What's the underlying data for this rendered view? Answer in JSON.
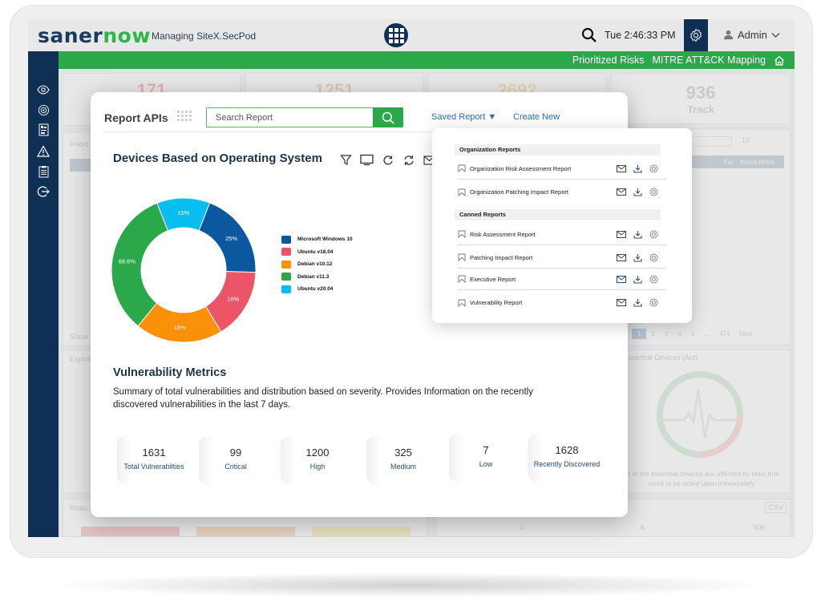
{
  "header": {
    "logo_part1": "saner",
    "logo_part2": "now",
    "managing_label": "Managing",
    "site_name": "SiteX.SecPod",
    "clock": "Tue 2:46:33 PM",
    "user": "Admin"
  },
  "greenbar": {
    "links": [
      "Prioritized Risks",
      "MITRE ATT&CK Mapping"
    ]
  },
  "sidebar": {
    "icons": [
      "eye-icon",
      "settings-flower-icon",
      "report-icon",
      "warning-icon",
      "clipboard-icon",
      "logout-icon"
    ]
  },
  "background": {
    "stat_cards": [
      {
        "value": "171",
        "label": "",
        "color": "#f2a0a0"
      },
      {
        "value": "1251",
        "label": "",
        "color": "#f6c3a0"
      },
      {
        "value": "2692",
        "label": "",
        "color": "#f4e0a0"
      },
      {
        "value": "936",
        "label": "Track",
        "color": "#c8c8c8"
      }
    ],
    "prioritized_label": "Priorit",
    "exploit_label": "Exploit",
    "show_label": "Show",
    "table_headers": [
      "Fix",
      "Know More"
    ],
    "page_size": "10",
    "pagination": [
      "1",
      "2",
      "3",
      "4",
      "5",
      "...",
      "474",
      "Next"
    ],
    "essential_title": "on Essential Devices (Act)",
    "essential_desc_line1": "% of the essential devices are affected by risks that",
    "essential_desc_line2": "need to be acted upon immediately",
    "risks_label": "Risks o",
    "csv_label": "CSV",
    "bottom_values": [
      "0",
      "6",
      "506"
    ]
  },
  "report_panel": {
    "title": "Report APIs",
    "search_placeholder": "Search Report",
    "saved_report_label": "Saved Report ▼",
    "create_new_label": "Create New",
    "chart_title": "Devices Based on Operating System",
    "vm_title": "Vulnerability Metrics",
    "vm_desc": "Summary of total vulnerabilities and distribution based on severity. Provides Information on the recently discovered vulnerabilities in the last 7 days.",
    "metrics": [
      {
        "value": "1631",
        "label": "Total Vulnerabilties"
      },
      {
        "value": "99",
        "label": "Critical"
      },
      {
        "value": "1200",
        "label": "High"
      },
      {
        "value": "325",
        "label": "Medium"
      },
      {
        "value": "7",
        "label": "Low"
      },
      {
        "value": "1628",
        "label": "Recently Discovered"
      }
    ]
  },
  "saved_reports": {
    "sections": [
      {
        "title": "Organization Reports",
        "items": [
          "Organization Risk Assessment Report",
          "Organization Patching Impact Report"
        ]
      },
      {
        "title": "Canned Reports",
        "items": [
          "Risk Assessment Report",
          "Patching Impact Report",
          "Executive Report",
          "Vulnerability Report"
        ]
      }
    ]
  },
  "chart_data": {
    "type": "pie",
    "title": "Devices Based on Operating System",
    "categories": [
      "Microsoft Windows 10",
      "Ubuntu v18.04",
      "Debian v10.12",
      "Debian v11.3",
      "Ubuntu v20.04"
    ],
    "values": [
      25,
      16,
      16,
      68.6,
      15
    ],
    "labels": [
      "25%",
      "16%",
      "16%",
      "68.6%",
      "15%"
    ],
    "colors": [
      "#0b57a0",
      "#ec5467",
      "#fb9009",
      "#2aa84a",
      "#08bdf0"
    ],
    "sweep_fractions": [
      0.196,
      0.158,
      0.196,
      0.331,
      0.119
    ],
    "legend": "right",
    "donut": true
  }
}
